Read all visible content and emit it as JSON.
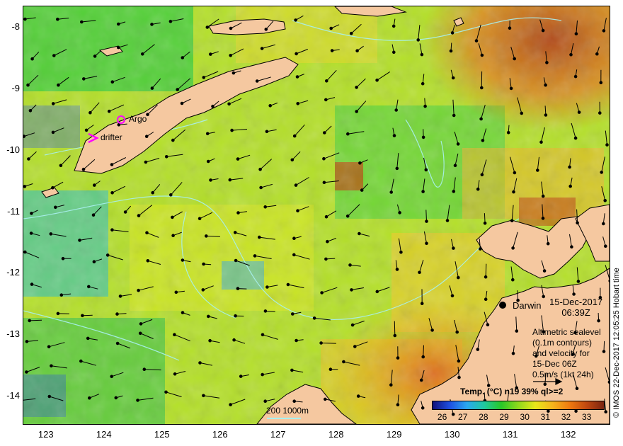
{
  "map": {
    "y_ticks": [
      "-8",
      "-9",
      "-10",
      "-11",
      "-12",
      "-13",
      "-14"
    ],
    "x_ticks": [
      "123",
      "124",
      "125",
      "126",
      "127",
      "128",
      "129",
      "130",
      "131",
      "132"
    ],
    "lat_range": [
      -14.45,
      -7.65
    ],
    "lon_range": [
      122.6,
      132.7
    ],
    "markers": {
      "argo_label": "Argo",
      "drifter_label": "drifter"
    },
    "city": {
      "name": "Darwin"
    },
    "date": {
      "line1": "15-Dec-2017",
      "line2": "06:39Z"
    },
    "legend": {
      "line1": "Altimetric sealevel",
      "line2": "(0.1m contours)",
      "line3": "and velocity for",
      "line4": "15-Dec 06Z",
      "line5": "0.5m/s (1kt 24h)"
    },
    "scale": {
      "label": "200 1000m"
    },
    "colorbar": {
      "title": "Temp. (°C) n19 39% ql>=2",
      "ticks": [
        "26",
        "27",
        "28",
        "29",
        "30",
        "31",
        "32",
        "33"
      ],
      "range": [
        25.5,
        33.8
      ],
      "colors": [
        "#10107a",
        "#1f4fe0",
        "#2aa8f0",
        "#20c8a0",
        "#28c828",
        "#8fd81c",
        "#e8e81a",
        "#f5b41c",
        "#f07a10",
        "#c04810",
        "#7a2410"
      ]
    },
    "copyright": "© IMOS 22-Dec-2017 12:05:25 Hobart time",
    "colors": {
      "land": "#f5c8a0",
      "contour": "#a8f0f0",
      "marker": "#ff00ff"
    }
  }
}
